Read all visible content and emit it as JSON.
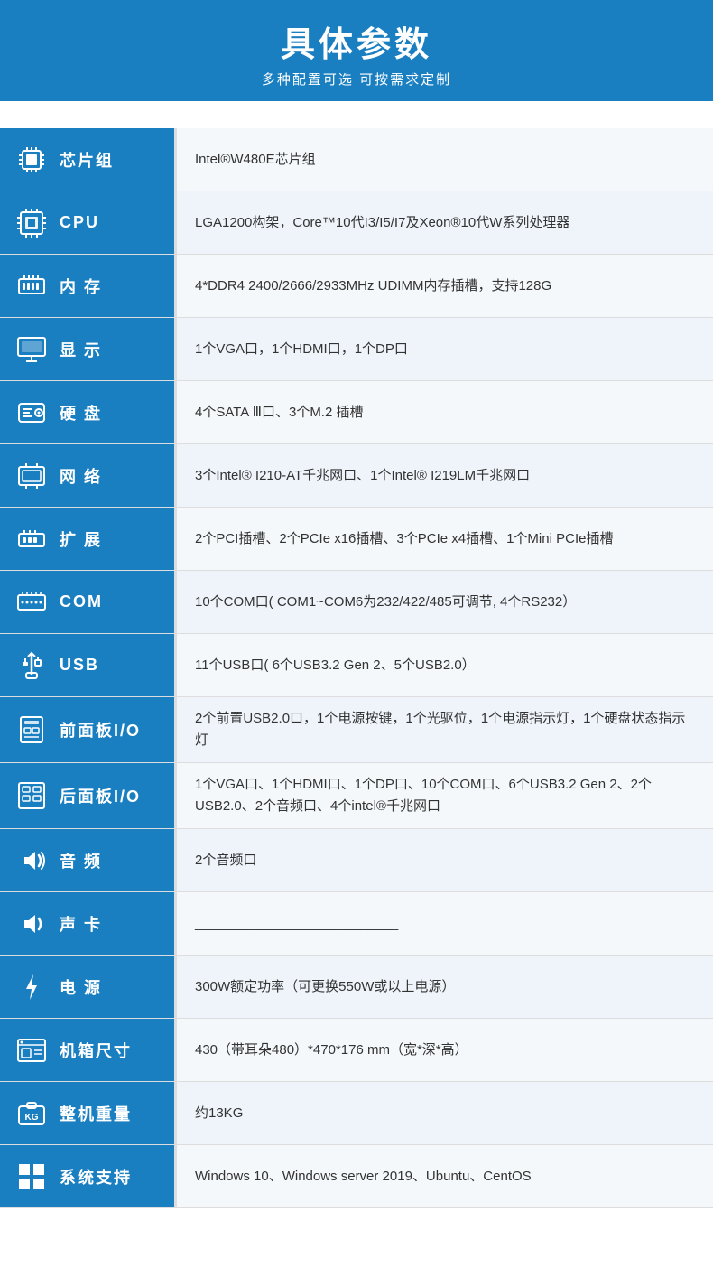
{
  "header": {
    "title": "具体参数",
    "subtitle": "多种配置可选 可按需求定制"
  },
  "rows": [
    {
      "id": "chipset",
      "label": "芯片组",
      "icon": "chip",
      "value": "Intel®W480E芯片组"
    },
    {
      "id": "cpu",
      "label": "CPU",
      "icon": "cpu",
      "value": "LGA1200构架，Core™10代I3/I5/I7及Xeon®10代W系列处理器"
    },
    {
      "id": "memory",
      "label": "内 存",
      "icon": "memory",
      "value": "4*DDR4 2400/2666/2933MHz  UDIMM内存插槽，支持128G"
    },
    {
      "id": "display",
      "label": "显 示",
      "icon": "display",
      "value": "1个VGA口，1个HDMI口，1个DP口"
    },
    {
      "id": "harddisk",
      "label": "硬 盘",
      "icon": "harddisk",
      "value": " 4个SATA Ⅲ口、3个M.2 插槽"
    },
    {
      "id": "network",
      "label": "网 络",
      "icon": "network",
      "value": "3个Intel® I210-AT千兆网口、1个Intel® I219LM千兆网口"
    },
    {
      "id": "expansion",
      "label": "扩 展",
      "icon": "expansion",
      "value": "2个PCI插槽、2个PCIe x16插槽、3个PCIe x4插槽、1个Mini PCIe插槽"
    },
    {
      "id": "com",
      "label": "COM",
      "icon": "com",
      "value": "10个COM口( COM1~COM6为232/422/485可调节, 4个RS232）"
    },
    {
      "id": "usb",
      "label": "USB",
      "icon": "usb",
      "value": "11个USB口( 6个USB3.2 Gen 2、5个USB2.0）"
    },
    {
      "id": "frontio",
      "label": "前面板I/O",
      "icon": "frontio",
      "value": "2个前置USB2.0口，1个电源按键，1个光驱位，1个电源指示灯，1个硬盘状态指示灯"
    },
    {
      "id": "reario",
      "label": "后面板I/O",
      "icon": "reario",
      "value": "1个VGA口、1个HDMI口、1个DP口、10个COM口、6个USB3.2 Gen 2、2个USB2.0、2个音频口、4个intel®千兆网口"
    },
    {
      "id": "audio",
      "label": "音 频",
      "icon": "audio",
      "value": "2个音频口"
    },
    {
      "id": "soundcard",
      "label": "声 卡",
      "icon": "soundcard",
      "value": "___________________________"
    },
    {
      "id": "power",
      "label": "电 源",
      "icon": "power",
      "value": "300W额定功率（可更换550W或以上电源）"
    },
    {
      "id": "chassis",
      "label": "机箱尺寸",
      "icon": "chassis",
      "value": "430（带耳朵480）*470*176 mm（宽*深*高）"
    },
    {
      "id": "weight",
      "label": "整机重量",
      "icon": "weight",
      "value": "约13KG"
    },
    {
      "id": "os",
      "label": "系统支持",
      "icon": "os",
      "value": "Windows 10、Windows server 2019、Ubuntu、CentOS"
    }
  ]
}
